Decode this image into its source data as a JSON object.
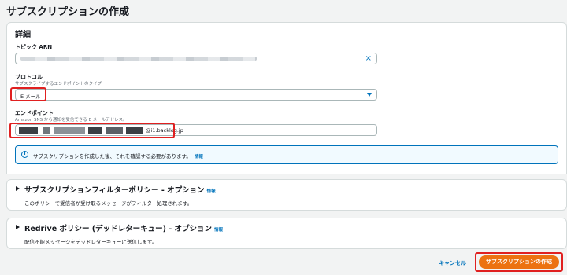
{
  "page": {
    "title": "サブスクリプションの作成"
  },
  "details": {
    "section_title": "詳細",
    "topic_arn": {
      "label": "トピック ARN"
    },
    "protocol": {
      "label": "プロトコル",
      "description": "サブスクライブするエンドポイントのタイプ",
      "selected": "E メール"
    },
    "endpoint": {
      "label": "エンドポイント",
      "description": "Amazon SNS から通知を受信できる E メールアドレス。",
      "value_suffix": "@i1.backlog.jp"
    },
    "info": {
      "text": "サブスクリプションを作成した後、それを確認する必要があります。",
      "link": "情報"
    }
  },
  "filter_policy": {
    "title": "サブスクリプションフィルターポリシー - オプション",
    "info": "情報",
    "description": "このポリシーで受信者が受け取るメッセージがフィルター処理されます。"
  },
  "redrive_policy": {
    "title": "Redrive ポリシー (デッドレターキュー) - オプション",
    "info": "情報",
    "description": "配信不能メッセージをデッドレターキューに送信します。"
  },
  "footer": {
    "cancel": "キャンセル",
    "create": "サブスクリプションの作成"
  },
  "colors": {
    "accent": "#0073bb",
    "primary_button": "#ec7211",
    "highlight": "#e02020"
  }
}
